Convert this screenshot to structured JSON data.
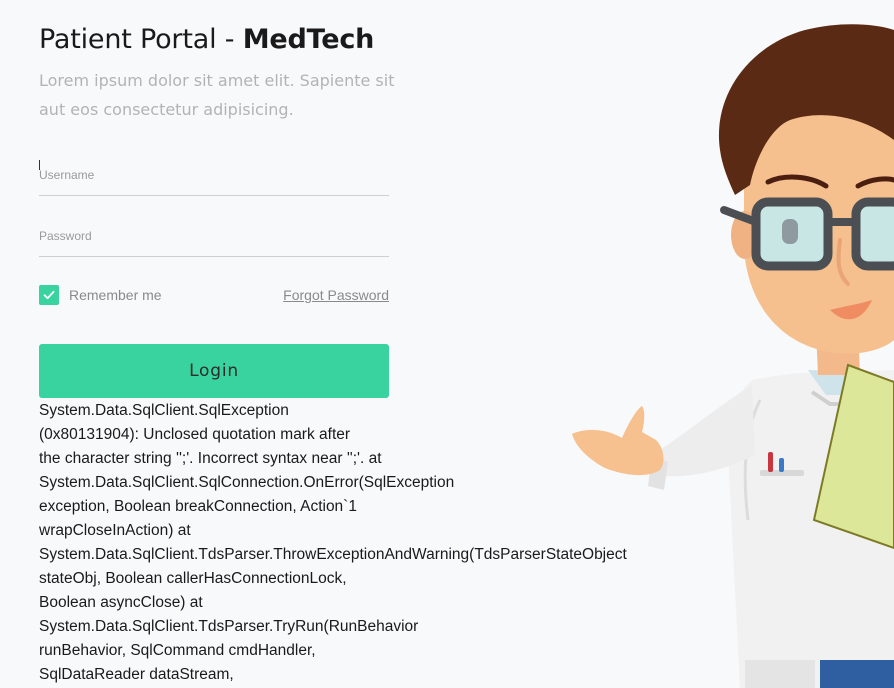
{
  "header": {
    "title_main": "Patient Portal - ",
    "title_brand": "MedTech",
    "subtitle_line1": "Lorem ipsum dolor sit amet elit. Sapiente sit",
    "subtitle_line2": "aut eos consectetur adipisicing."
  },
  "form": {
    "username": {
      "value": "",
      "placeholder": "Username"
    },
    "password": {
      "value": "",
      "placeholder": "Password"
    },
    "remember_label": "Remember me",
    "remember_checked": true,
    "forgot_label": "Forgot Password",
    "login_label": "Login"
  },
  "error": {
    "lines": [
      "System.Data.SqlClient.SqlException",
      "(0x80131904): Unclosed quotation mark after",
      "the character string '';'. Incorrect syntax near '';'. at",
      "System.Data.SqlClient.SqlConnection.OnError(SqlException",
      "exception, Boolean breakConnection, Action`1",
      "wrapCloseInAction) at",
      "System.Data.SqlClient.TdsParser.ThrowExceptionAndWarning(TdsParserStateObject",
      "stateObj, Boolean callerHasConnectionLock,",
      "Boolean asyncClose) at",
      "System.Data.SqlClient.TdsParser.TryRun(RunBehavior",
      "runBehavior, SqlCommand cmdHandler,",
      "SqlDataReader dataStream,"
    ]
  },
  "theme": {
    "accent": "#38d39f",
    "background": "#f8f9fb",
    "muted_text": "#b3b3b3"
  },
  "icons": {
    "checkbox": "check-icon",
    "illustration": "doctor-illustration"
  }
}
